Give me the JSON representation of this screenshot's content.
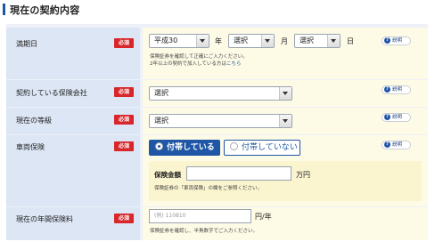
{
  "section": {
    "title": "現在の契約内容"
  },
  "rows": {
    "expiry": {
      "label": "満期日",
      "required": "必須",
      "era_select": "平成30",
      "year_unit": "年",
      "month_select": "選択",
      "month_unit": "月",
      "day_select": "選択",
      "day_unit": "日",
      "note_line1": "保険証券を確認して正確にご入力ください。",
      "note_line2_prefix": "2年以上の契約で加入している方は",
      "note_line2_link": "こちら",
      "help": "説明"
    },
    "company": {
      "label": "契約している保険会社",
      "required": "必須",
      "select": "選択",
      "help": "説明"
    },
    "grade": {
      "label": "現在の等級",
      "required": "必須",
      "select": "選択",
      "help": "説明"
    },
    "vehicle": {
      "label": "車両保険",
      "required": "必須",
      "option_on": "付帯している",
      "option_off": "付帯していない",
      "amount_label": "保険金額",
      "amount_value": "",
      "amount_unit": "万円",
      "amount_note": "保険証券の「車両保険」の欄をご参照ください。",
      "help": "説明"
    },
    "premium": {
      "label": "現在の年間保険料",
      "required": "必須",
      "placeholder": "(例) 110810",
      "unit": "円/年",
      "note": "保険証券を確認し、半角数字でご入力ください。"
    }
  }
}
